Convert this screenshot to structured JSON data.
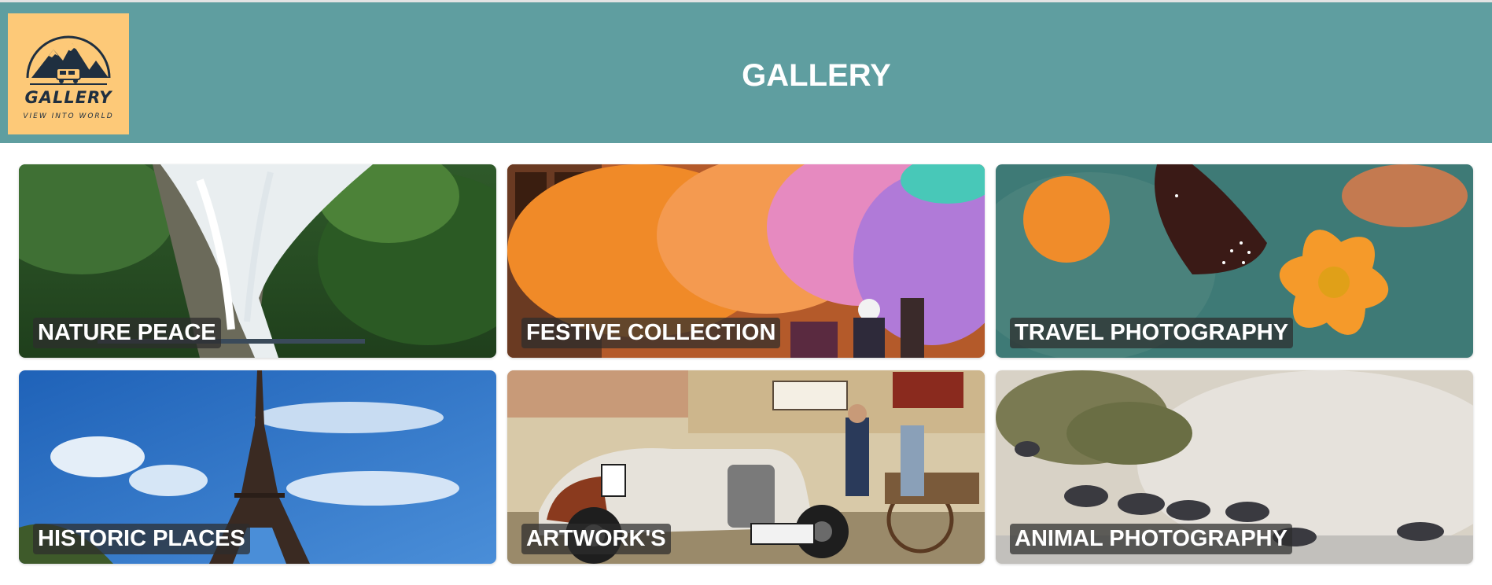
{
  "header": {
    "title": "GALLERY",
    "logo": {
      "word": "GALLERY",
      "tagline": "VIEW INTO WORLD"
    }
  },
  "gallery": {
    "cards": [
      {
        "label": "NATURE PEACE",
        "image": "waterfall-forest"
      },
      {
        "label": "FESTIVE COLLECTION",
        "image": "holi-color-festival"
      },
      {
        "label": "TRAVEL PHOTOGRAPHY",
        "image": "butterfly-on-orange-flower"
      },
      {
        "label": "HISTORIC PLACES",
        "image": "eiffel-tower-blue-sky"
      },
      {
        "label": "ARTWORK'S",
        "image": "vintage-car-painting"
      },
      {
        "label": "ANIMAL PHOTOGRAPHY",
        "image": "wildebeest-river-crossing"
      }
    ]
  },
  "colors": {
    "header_bg": "#5f9ea0",
    "logo_bg": "#fdc978",
    "logo_ink": "#1f2f40",
    "label_bg": "#2d2d2d",
    "label_text": "#ffffff"
  }
}
